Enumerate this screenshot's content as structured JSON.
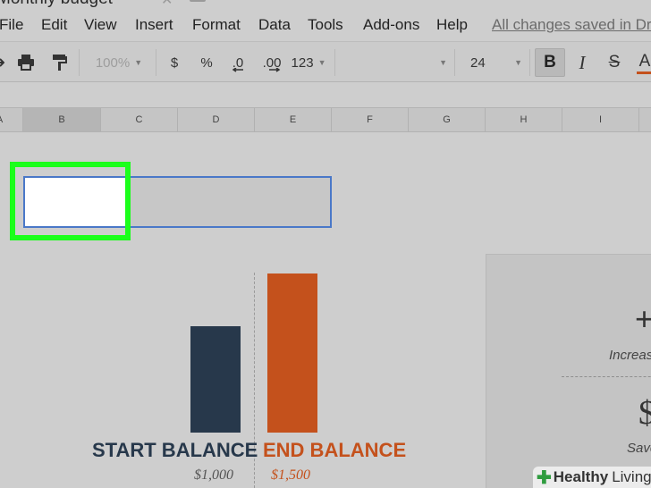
{
  "doc": {
    "title": "Monthly budget",
    "saved_status": "All changes saved in Dr"
  },
  "menu": [
    "File",
    "Edit",
    "View",
    "Insert",
    "Format",
    "Data",
    "Tools",
    "Add-ons",
    "Help"
  ],
  "toolbar": {
    "zoom": "100%",
    "currency": "$",
    "percent": "%",
    "decrease_decimal": ".0",
    "increase_decimal": ".00",
    "number_format": "123",
    "font_size": "24",
    "bold": "B",
    "italic": "I",
    "strike": "S",
    "text_color": "A"
  },
  "columns": [
    "A",
    "B",
    "C",
    "D",
    "E",
    "F",
    "G",
    "H",
    "I"
  ],
  "selected_column": "B",
  "chart": {
    "start_label": "START BALANCE",
    "start_value": "$1,000",
    "end_label": "END BALANCE",
    "end_value": "$1,500",
    "start_color": "#27384b",
    "end_color": "#c4511c"
  },
  "panel": {
    "increase_icon": "+",
    "increase_text": "Increas",
    "savings_icon": "$",
    "savings_text": "Save"
  },
  "watermark": {
    "brand": "Healthy",
    "suffix": "Living"
  },
  "colors": {
    "highlight": "#1bff1b",
    "selection": "#4a78c8"
  }
}
